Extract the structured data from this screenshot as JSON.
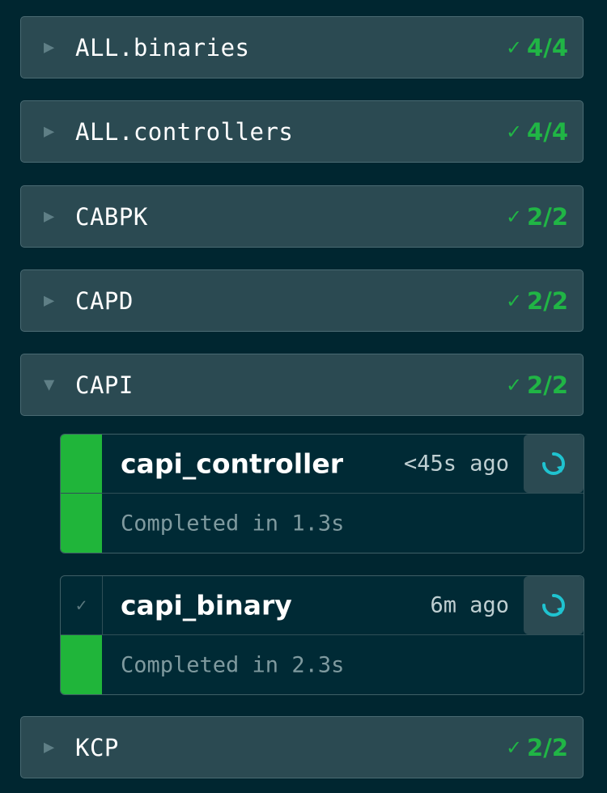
{
  "groups": [
    {
      "name": "ALL.binaries",
      "count": "4/4",
      "expanded": false
    },
    {
      "name": "ALL.controllers",
      "count": "4/4",
      "expanded": false
    },
    {
      "name": "CABPK",
      "count": "2/2",
      "expanded": false
    },
    {
      "name": "CAPD",
      "count": "2/2",
      "expanded": false
    },
    {
      "name": "CAPI",
      "count": "2/2",
      "expanded": true
    },
    {
      "name": "KCP",
      "count": "2/2",
      "expanded": false
    }
  ],
  "builds": [
    {
      "name": "capi_controller",
      "ago": "<45s ago",
      "status": "Completed in 1.3s"
    },
    {
      "name": "capi_binary",
      "ago": "6m ago",
      "status": "Completed in 2.3s"
    }
  ],
  "icons": {
    "collapsed": "triangle-right-icon",
    "expanded": "triangle-down-icon",
    "success": "check-icon",
    "rerun": "rerun-icon"
  },
  "colors": {
    "background": "#002630",
    "group_bg": "#2b4a52",
    "success": "#20b53a",
    "accent": "#1fc3d0"
  }
}
